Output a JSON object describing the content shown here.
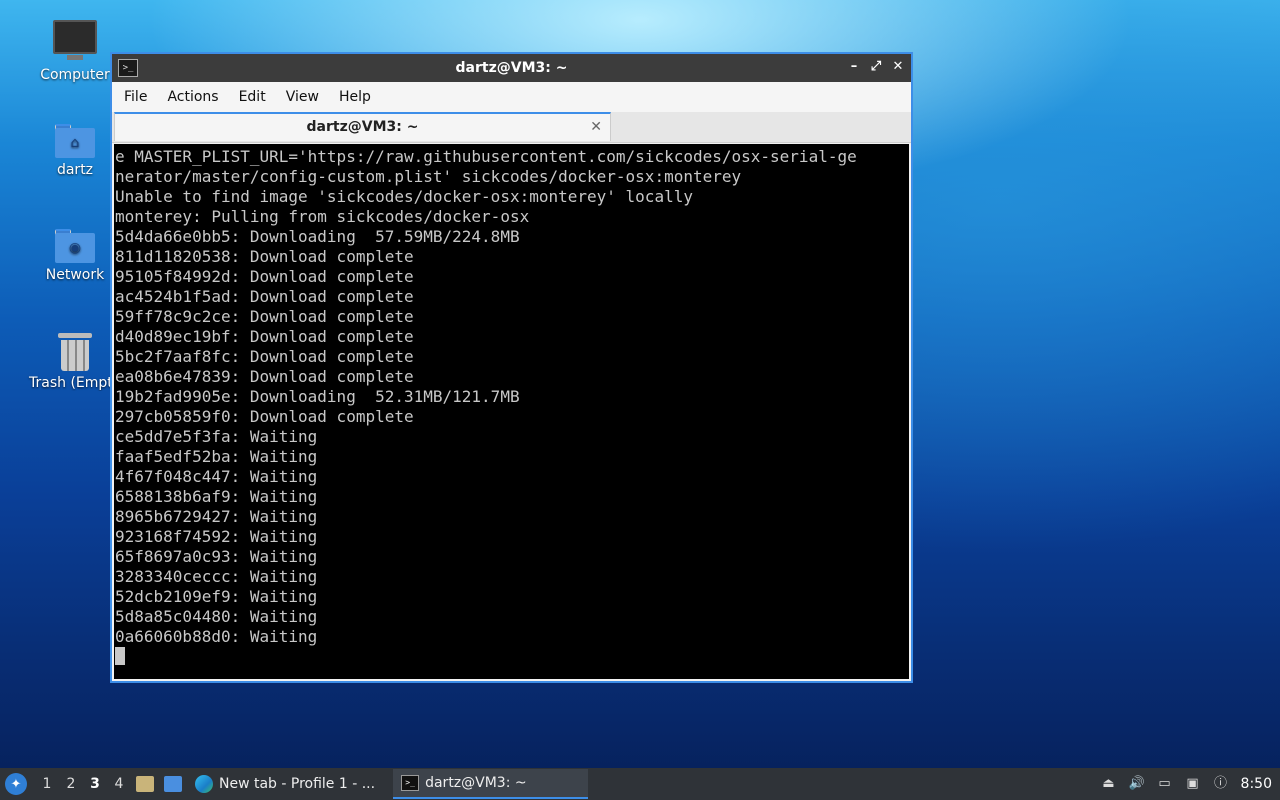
{
  "desktop": {
    "icons": [
      {
        "label": "Computer"
      },
      {
        "label": "dartz"
      },
      {
        "label": "Network"
      },
      {
        "label": "Trash (Empty)"
      }
    ]
  },
  "window": {
    "title": "dartz@VM3: ~",
    "app_icon": ">_",
    "controls": {
      "minimize": "–",
      "maximize": "⤢",
      "close": "✕"
    },
    "menu": [
      "File",
      "Actions",
      "Edit",
      "View",
      "Help"
    ],
    "tab": {
      "label": "dartz@VM3: ~",
      "close": "✕"
    },
    "terminal_lines": [
      "e MASTER_PLIST_URL='https://raw.githubusercontent.com/sickcodes/osx-serial-ge",
      "nerator/master/config-custom.plist' sickcodes/docker-osx:monterey",
      "Unable to find image 'sickcodes/docker-osx:monterey' locally",
      "monterey: Pulling from sickcodes/docker-osx",
      "5d4da66e0bb5: Downloading  57.59MB/224.8MB",
      "811d11820538: Download complete",
      "95105f84992d: Download complete",
      "ac4524b1f5ad: Download complete",
      "59ff78c9c2ce: Download complete",
      "d40d89ec19bf: Download complete",
      "5bc2f7aaf8fc: Download complete",
      "ea08b6e47839: Download complete",
      "19b2fad9905e: Downloading  52.31MB/121.7MB",
      "297cb05859f0: Download complete",
      "ce5dd7e5f3fa: Waiting",
      "faaf5edf52ba: Waiting",
      "4f67f048c447: Waiting",
      "6588138b6af9: Waiting",
      "8965b6729427: Waiting",
      "923168f74592: Waiting",
      "65f8697a0c93: Waiting",
      "3283340ceccc: Waiting",
      "52dcb2109ef9: Waiting",
      "5d8a85c04480: Waiting",
      "0a66060b88d0: Waiting"
    ]
  },
  "taskbar": {
    "workspaces": [
      "1",
      "2",
      "3",
      "4"
    ],
    "active_workspace": "3",
    "tasks": [
      {
        "label": "New tab - Profile 1 - ...",
        "icon": "edge-icon"
      },
      {
        "label": "dartz@VM3: ~",
        "icon": "terminal-icon"
      }
    ],
    "clock": "8:50"
  },
  "colors": {
    "accent": "#3d8ee8",
    "terminal_bg": "#000000",
    "terminal_fg": "#c8c8c8",
    "titlebar": "#3c3c3c",
    "taskbar": "#2f3338"
  }
}
